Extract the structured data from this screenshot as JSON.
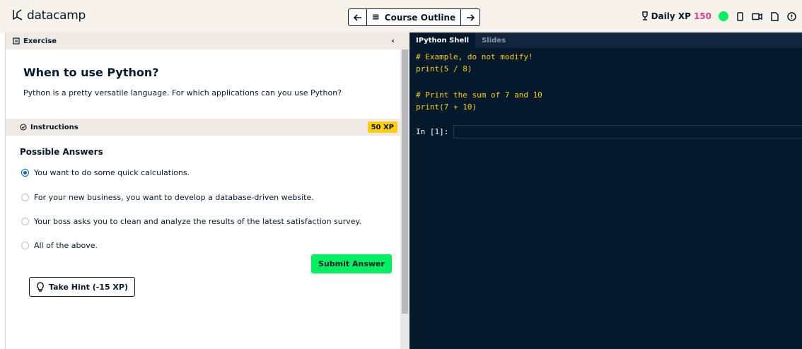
{
  "topbar": {
    "logo_text": "datacamp",
    "prev_icon": "arrow-left-icon",
    "course_outline_label": "Course Outline",
    "next_icon": "arrow-right-icon",
    "daily_xp_label": "Daily XP",
    "daily_xp_value": "150",
    "status_color": "#03ef62",
    "icons": [
      "trophy-icon",
      "mobile-icon",
      "video-icon",
      "slides-icon",
      "info-icon"
    ]
  },
  "left": {
    "exercise_label": "Exercise",
    "title": "When to use Python?",
    "description": "Python is a pretty versatile language. For which applications can you use Python?",
    "instructions_label": "Instructions",
    "xp_badge": "50 XP",
    "answers_title": "Possible Answers",
    "answers": [
      {
        "text": "You want to do some quick calculations.",
        "selected": true
      },
      {
        "text": "For your new business, you want to develop a database-driven website.",
        "selected": false
      },
      {
        "text": "Your boss asks you to clean and analyze the results of the latest satisfaction survey.",
        "selected": false
      },
      {
        "text": "All of the above.",
        "selected": false
      }
    ],
    "submit_label": "Submit Answer",
    "hint_label": "Take Hint (-15 XP)"
  },
  "right": {
    "tabs": [
      "IPython Shell",
      "Slides"
    ],
    "code_lines": [
      "# Example, do not modify!",
      "print(5 / 8)",
      "",
      "# Print the sum of 7 and 10",
      "print(7 + 10)"
    ],
    "prompt": "In [1]:"
  },
  "colors": {
    "accent_green": "#03ef62",
    "xp_pink": "#dd3c8a",
    "badge_yellow": "#fcce0d",
    "editor_bg": "#05192d",
    "code_color": "#fcce0d"
  }
}
